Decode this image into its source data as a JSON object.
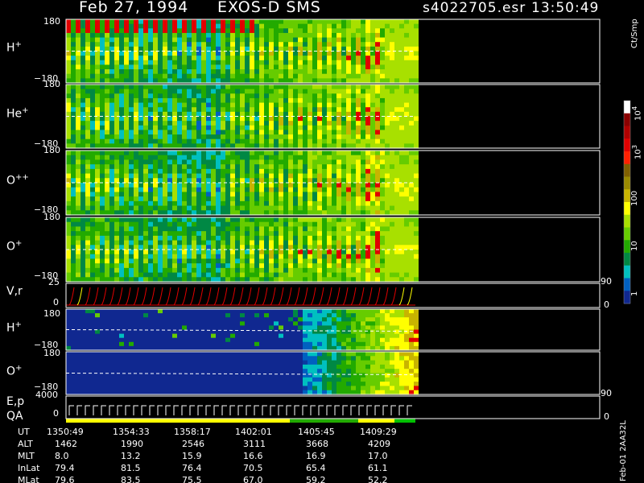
{
  "header": {
    "date": "Feb 27, 1994",
    "instrument": "EXOS-D SMS",
    "file": "s4022705.esr",
    "time": "13:50:49"
  },
  "panels": [
    {
      "label": "H",
      "charge": "+",
      "ymax": "180",
      "ymin": "−180"
    },
    {
      "label": "He",
      "charge": "+",
      "ymax": "180",
      "ymin": "−180"
    },
    {
      "label": "O",
      "charge": "++",
      "ymax": "180",
      "ymin": "−180"
    },
    {
      "label": "O",
      "charge": "+",
      "ymax": "180",
      "ymin": "−180"
    },
    {
      "label": "V,r",
      "charge": "",
      "ymax": "25",
      "ymin": "0",
      "rmax": "90",
      "rmin": "0"
    },
    {
      "label": "H",
      "charge": "+",
      "ymax": "180",
      "ymin": "−180"
    },
    {
      "label": "O",
      "charge": "+",
      "ymax": "180",
      "ymin": "−180"
    },
    {
      "label": "E,p",
      "label2": "QA",
      "ymax": "4000",
      "ymin": "0",
      "rmax": "90",
      "rmin": "0"
    }
  ],
  "colorbar": {
    "unit": "Ct/Smp",
    "labels": [
      {
        "base": "10",
        "exp": "4"
      },
      {
        "base": "10",
        "exp": "3"
      },
      {
        "base": "100",
        "exp": ""
      },
      {
        "base": "10",
        "exp": ""
      },
      {
        "base": "1",
        "exp": ""
      }
    ],
    "colors": [
      "#ffffff",
      "#8b0000",
      "#b00000",
      "#e00000",
      "#ff2000",
      "#806000",
      "#9a8a00",
      "#c8b400",
      "#ffff00",
      "#a8e000",
      "#66cc00",
      "#22aa00",
      "#008844",
      "#00c0c0",
      "#0060c0",
      "#102890"
    ]
  },
  "side_label": "Feb-01 2AA32L",
  "footer": {
    "row_labels": [
      "UT",
      "ALT",
      "MLT",
      "InLat",
      "MLat"
    ],
    "columns": [
      [
        "1350:49",
        "1462",
        "8.0",
        "79.4",
        "79.6"
      ],
      [
        "1354:33",
        "1990",
        "13.2",
        "81.5",
        "83.5"
      ],
      [
        "1358:17",
        "2546",
        "15.9",
        "76.4",
        "75.5"
      ],
      [
        "1402:01",
        "3111",
        "16.6",
        "70.5",
        "67.0"
      ],
      [
        "1405:45",
        "3668",
        "16.9",
        "65.4",
        "59.2"
      ],
      [
        "1409:29",
        "4209",
        "17.0",
        "61.1",
        "52.2"
      ]
    ]
  },
  "chart_data": {
    "type": "heatmap",
    "title": "Feb 27, 1994   EXOS-D SMS",
    "x": [
      "1350:49",
      "1354:33",
      "1358:17",
      "1402:01",
      "1405:45",
      "1409:29"
    ],
    "panels": [
      "H+",
      "He+",
      "O++",
      "O+",
      "V,r",
      "H+",
      "O+",
      "E,p QA"
    ],
    "pitch_range": [
      -180,
      180
    ],
    "color_scale": "log",
    "color_range": [
      1,
      10000
    ],
    "color_unit": "Ct/Smp"
  }
}
